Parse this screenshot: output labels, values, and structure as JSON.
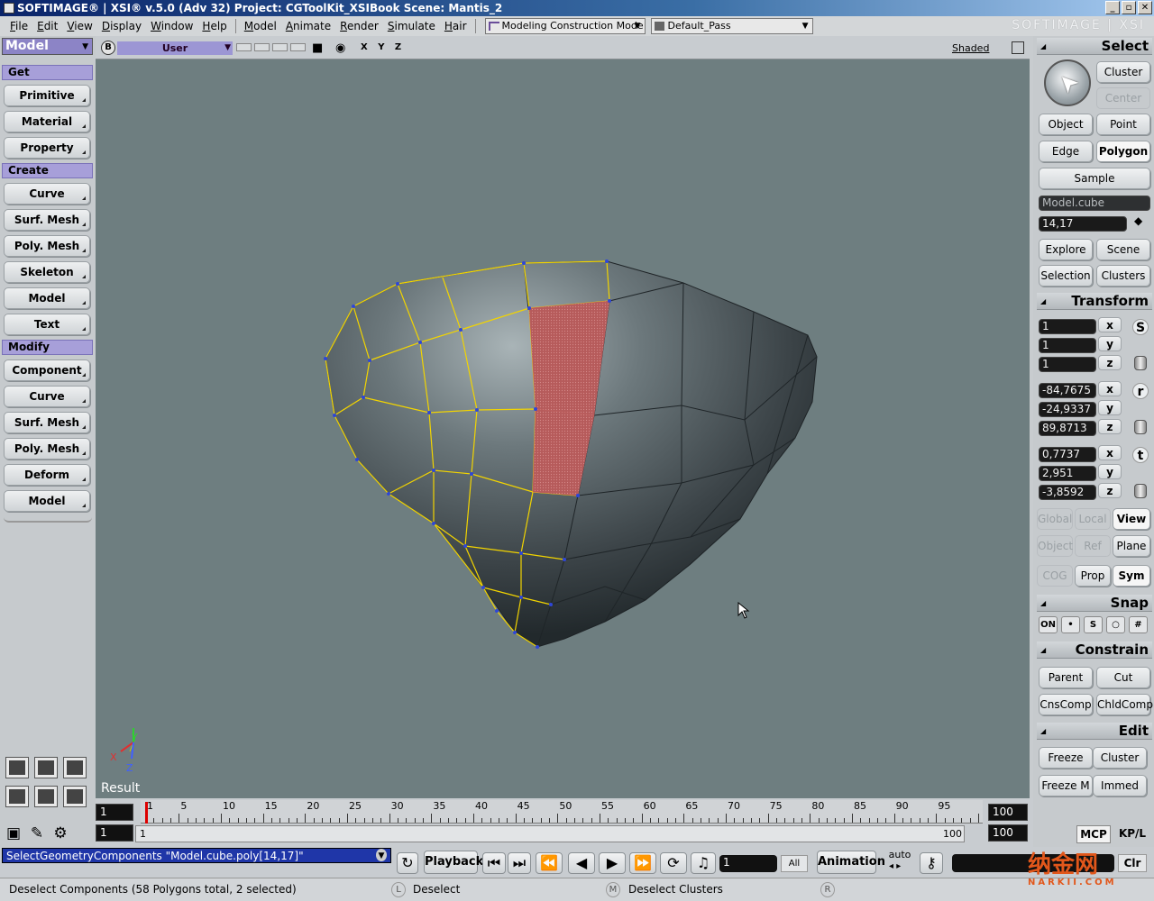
{
  "title": {
    "text": "SOFTIMAGE® | XSI® v.5.0 (Adv 32) Project: CGToolKit_XSIBook    Scene: Mantis_2"
  },
  "window_buttons": [
    "_",
    "▫",
    "✕"
  ],
  "menu": {
    "items": [
      "File",
      "Edit",
      "View",
      "Display",
      "Window",
      "Help"
    ],
    "modules": [
      "Model",
      "Animate",
      "Render",
      "Simulate",
      "Hair"
    ],
    "construction_mode": "Modeling Construction Mode",
    "pass": "Default_Pass",
    "brand": "SOFTIMAGE | XSI"
  },
  "left": {
    "module": "Model",
    "sections": {
      "get": "Get",
      "create": "Create",
      "modify": "Modify"
    },
    "get_items": [
      "Primitive",
      "Material",
      "Property"
    ],
    "create_items": [
      "Curve",
      "Surf. Mesh",
      "Poly. Mesh",
      "Skeleton",
      "Model",
      "Text"
    ],
    "modify_items": [
      "Component",
      "Curve",
      "Surf. Mesh",
      "Poly. Mesh",
      "Deform",
      "Model"
    ]
  },
  "viewport": {
    "view_letter": "B",
    "camera": "User",
    "xyz": "X Y Z",
    "display_mode": "Shaded",
    "result_label": "Result",
    "axis_x": "X",
    "axis_y": "Y",
    "axis_z": "Z"
  },
  "right": {
    "select_header": "Select",
    "cluster": "Cluster",
    "center": "Center",
    "object": "Object",
    "point": "Point",
    "edge": "Edge",
    "polygon": "Polygon",
    "sample": "Sample",
    "selection_name": "Model.cube",
    "selection_ids": "14,17",
    "explore": "Explore",
    "scene": "Scene",
    "selection": "Selection",
    "clusters": "Clusters",
    "transform_header": "Transform",
    "scale": [
      "1",
      "1",
      "1"
    ],
    "rotation": [
      "-84,7675",
      "-24,9337",
      "89,8713"
    ],
    "translation": [
      "0,7737",
      "2,951",
      "-3,8592"
    ],
    "axes": [
      "x",
      "y",
      "z"
    ],
    "trs": [
      "S",
      "r",
      "t"
    ],
    "global": "Global",
    "local": "Local",
    "view": "View",
    "object_ref": "Object",
    "ref": "Ref",
    "plane": "Plane",
    "cog": "COG",
    "prop": "Prop",
    "sym": "Sym",
    "snap_header": "Snap",
    "snap_on": "ON",
    "constrain_header": "Constrain",
    "parent": "Parent",
    "cut": "Cut",
    "cnscomp": "CnsComp",
    "chldcomp": "ChldComp",
    "edit_header": "Edit",
    "freeze": "Freeze",
    "edit_cluster": "Cluster",
    "freeze_m": "Freeze M",
    "immed": "Immed"
  },
  "timeline": {
    "start": "1",
    "end": "100",
    "range_start": "1",
    "range_end": "1",
    "range_end2": "100",
    "range_end3": "100",
    "labels": [
      "1",
      "5",
      "10",
      "15",
      "20",
      "25",
      "30",
      "35",
      "40",
      "45",
      "50",
      "55",
      "60",
      "65",
      "70",
      "75",
      "80",
      "85",
      "90",
      "95"
    ],
    "mcp": "MCP",
    "kpl": "KP/L"
  },
  "command": {
    "text": "SelectGeometryComponents \"Model.cube.poly[14,17]\"",
    "playback": "Playback",
    "frame": "1",
    "all": "All",
    "animation": "Animation",
    "auto": "auto",
    "clr": "Clr"
  },
  "status": {
    "message": "Deselect Components (58 Polygons total, 2 selected)",
    "l_key": "L",
    "l_action": "Deselect",
    "m_key": "M",
    "m_action": "Deselect Clusters",
    "r_key": "R"
  },
  "watermark": {
    "main": "纳金网",
    "sub": "NARKII.COM"
  }
}
